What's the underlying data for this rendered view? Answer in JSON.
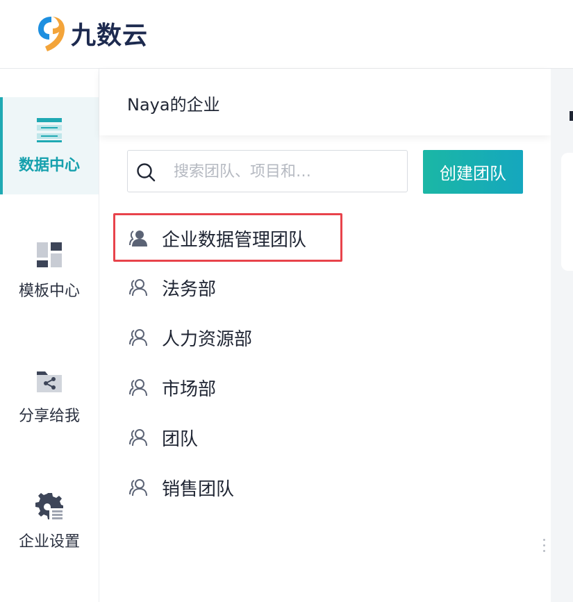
{
  "brand": {
    "name": "九数云",
    "colors": {
      "primary_blue": "#1d8fe0",
      "accent_orange": "#f3a43a",
      "teal": "#1fa9b3"
    }
  },
  "sidebar": {
    "items": [
      {
        "label": "数据中心",
        "icon": "data-center-icon",
        "active": true
      },
      {
        "label": "模板中心",
        "icon": "template-icon",
        "active": false
      },
      {
        "label": "分享给我",
        "icon": "shared-folder-icon",
        "active": false
      },
      {
        "label": "企业设置",
        "icon": "gear-settings-icon",
        "active": false
      }
    ]
  },
  "panel": {
    "title": "Naya的企业",
    "search": {
      "placeholder": "搜索团队、项目和…",
      "value": ""
    },
    "create_button": "创建团队",
    "teams": [
      {
        "label": "企业数据管理团队",
        "selected": true
      },
      {
        "label": "法务部",
        "selected": false
      },
      {
        "label": "人力资源部",
        "selected": false
      },
      {
        "label": "市场部",
        "selected": false
      },
      {
        "label": "团队",
        "selected": false
      },
      {
        "label": "销售团队",
        "selected": false
      }
    ]
  }
}
